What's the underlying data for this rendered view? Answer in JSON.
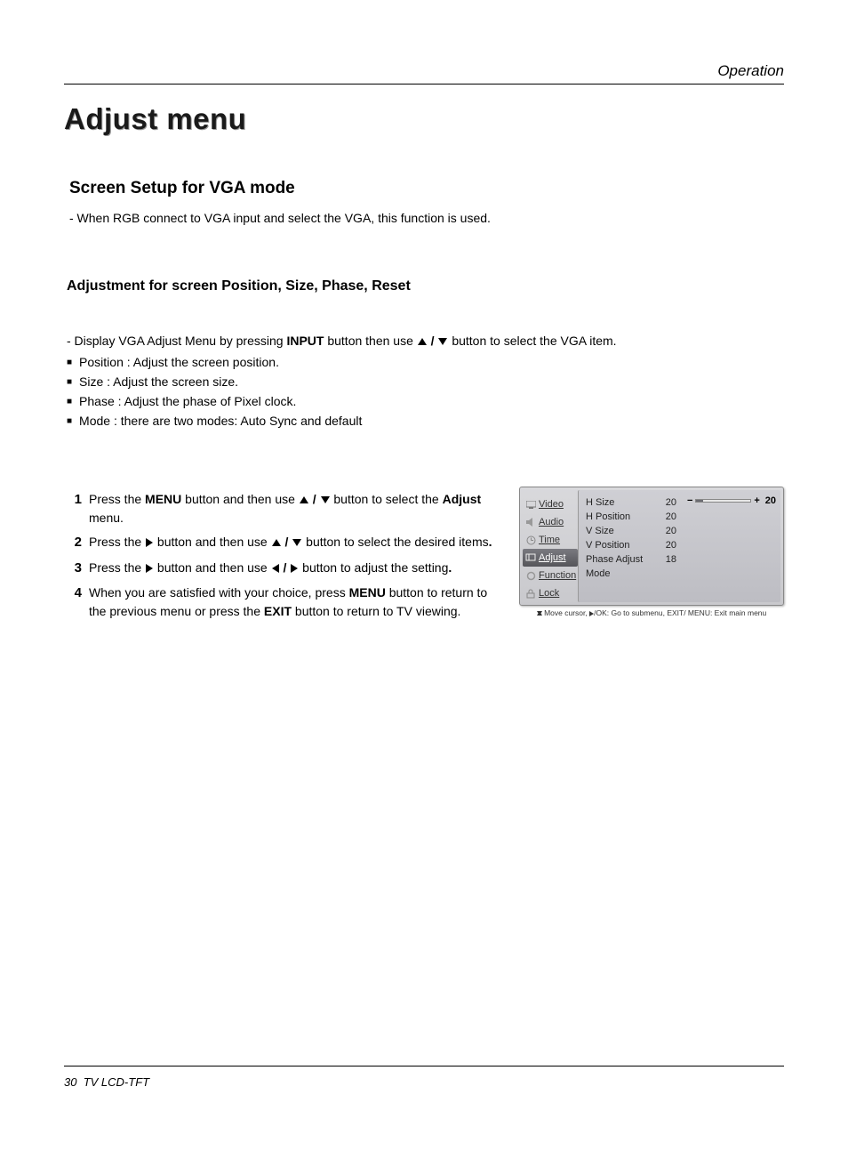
{
  "header": {
    "section": "Operation"
  },
  "page_title": "Adjust menu",
  "section_title": "Screen Setup for VGA mode",
  "section_desc": "- When RGB connect to VGA input and select the VGA, this function is used.",
  "subsection_title": "Adjustment for screen Position, Size, Phase, Reset",
  "bullet_intro_pre": "- Display VGA Adjust Menu by pressing ",
  "bullet_intro_bold": "INPUT",
  "bullet_intro_mid": " button then use ",
  "bullet_intro_post": " button to select the VGA item.",
  "bullets": [
    "Position : Adjust the screen position.",
    "Size : Adjust the screen size.",
    "Phase : Adjust the phase of Pixel clock.",
    "Mode : there are two modes: Auto Sync and default"
  ],
  "steps": {
    "s1_a": "Press the ",
    "s1_menu": "MENU",
    "s1_b": " button and then use ",
    "s1_c": " button to select the ",
    "s1_adjust": "Adjust",
    "s1_d": " menu.",
    "s2_a": "Press the ",
    "s2_b": " button and then use ",
    "s2_c": " button to select the desired items",
    "s2_dot": ".",
    "s3_a": "Press the ",
    "s3_b": " button and then use ",
    "s3_c": " button to adjust the setting",
    "s3_dot": ".",
    "s4_a": "When you are satisfied with your choice, press ",
    "s4_menu": "MENU",
    "s4_b": " button to return to the previous menu or press the ",
    "s4_exit": "EXIT",
    "s4_c": " button to return to TV viewing."
  },
  "osd": {
    "tabs": [
      "Video",
      "Audio",
      "Time",
      "Adjust",
      "Function",
      "Lock"
    ],
    "selected_tab": "Adjust",
    "params": [
      {
        "name": "H Size",
        "value": "20"
      },
      {
        "name": "H Position",
        "value": "20"
      },
      {
        "name": "V Size",
        "value": "20"
      },
      {
        "name": "V Position",
        "value": "20"
      },
      {
        "name": "Phase Adjust",
        "value": "18"
      },
      {
        "name": "Mode",
        "value": ""
      }
    ],
    "slider": {
      "minus": "−",
      "plus": "+",
      "value": "20"
    },
    "hint_a": " Move cursor, ",
    "hint_b": "/OK: Go to submenu, EXIT/ MENU: Exit main menu"
  },
  "footer": {
    "page": "30",
    "label": "TV LCD-TFT"
  }
}
